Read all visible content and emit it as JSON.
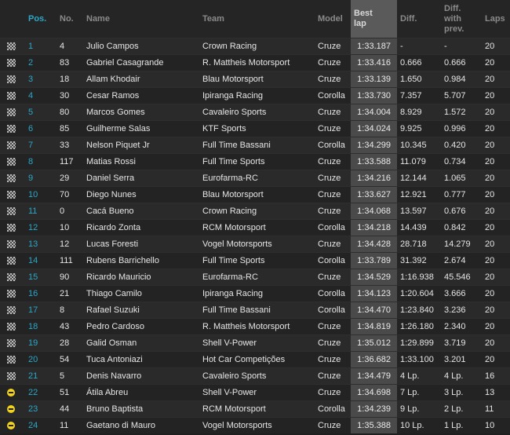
{
  "headers": {
    "pos": "Pos.",
    "no": "No.",
    "name": "Name",
    "team": "Team",
    "model": "Model",
    "best_lap_1": "Best",
    "best_lap_2": "lap",
    "diff": "Diff.",
    "diff_prev_1": "Diff.",
    "diff_prev_2": "with",
    "diff_prev_3": "prev.",
    "laps": "Laps"
  },
  "rows": [
    {
      "flag": "checkered-flag-icon",
      "pos": "1",
      "no": "4",
      "name": "Julio Campos",
      "team": "Crown Racing",
      "model": "Cruze",
      "best": "1:33.187",
      "diff": "-",
      "prev": "-",
      "laps": "20"
    },
    {
      "flag": "checkered-flag-icon",
      "pos": "2",
      "no": "83",
      "name": "Gabriel Casagrande",
      "team": "R. Mattheis Motorsport",
      "model": "Cruze",
      "best": "1:33.416",
      "diff": "0.666",
      "prev": "0.666",
      "laps": "20"
    },
    {
      "flag": "checkered-flag-icon",
      "pos": "3",
      "no": "18",
      "name": "Allam Khodair",
      "team": "Blau Motorsport",
      "model": "Cruze",
      "best": "1:33.139",
      "diff": "1.650",
      "prev": "0.984",
      "laps": "20"
    },
    {
      "flag": "checkered-flag-icon",
      "pos": "4",
      "no": "30",
      "name": "Cesar Ramos",
      "team": "Ipiranga Racing",
      "model": "Corolla",
      "best": "1:33.730",
      "diff": "7.357",
      "prev": "5.707",
      "laps": "20"
    },
    {
      "flag": "checkered-flag-icon",
      "pos": "5",
      "no": "80",
      "name": "Marcos Gomes",
      "team": "Cavaleiro Sports",
      "model": "Cruze",
      "best": "1:34.004",
      "diff": "8.929",
      "prev": "1.572",
      "laps": "20"
    },
    {
      "flag": "checkered-flag-icon",
      "pos": "6",
      "no": "85",
      "name": "Guilherme Salas",
      "team": "KTF Sports",
      "model": "Cruze",
      "best": "1:34.024",
      "diff": "9.925",
      "prev": "0.996",
      "laps": "20"
    },
    {
      "flag": "checkered-flag-icon",
      "pos": "7",
      "no": "33",
      "name": "Nelson Piquet Jr",
      "team": "Full Time Bassani",
      "model": "Corolla",
      "best": "1:34.299",
      "diff": "10.345",
      "prev": "0.420",
      "laps": "20"
    },
    {
      "flag": "checkered-flag-icon",
      "pos": "8",
      "no": "117",
      "name": "Matias Rossi",
      "team": "Full Time Sports",
      "model": "Cruze",
      "best": "1:33.588",
      "diff": "11.079",
      "prev": "0.734",
      "laps": "20"
    },
    {
      "flag": "checkered-flag-icon",
      "pos": "9",
      "no": "29",
      "name": "Daniel Serra",
      "team": "Eurofarma-RC",
      "model": "Cruze",
      "best": "1:34.216",
      "diff": "12.144",
      "prev": "1.065",
      "laps": "20"
    },
    {
      "flag": "checkered-flag-icon",
      "pos": "10",
      "no": "70",
      "name": "Diego Nunes",
      "team": "Blau Motorsport",
      "model": "Cruze",
      "best": "1:33.627",
      "diff": "12.921",
      "prev": "0.777",
      "laps": "20"
    },
    {
      "flag": "checkered-flag-icon",
      "pos": "11",
      "no": "0",
      "name": "Cacá Bueno",
      "team": "Crown Racing",
      "model": "Cruze",
      "best": "1:34.068",
      "diff": "13.597",
      "prev": "0.676",
      "laps": "20"
    },
    {
      "flag": "checkered-flag-icon",
      "pos": "12",
      "no": "10",
      "name": "Ricardo Zonta",
      "team": "RCM Motorsport",
      "model": "Corolla",
      "best": "1:34.218",
      "diff": "14.439",
      "prev": "0.842",
      "laps": "20"
    },
    {
      "flag": "checkered-flag-icon",
      "pos": "13",
      "no": "12",
      "name": "Lucas Foresti",
      "team": "Vogel Motorsports",
      "model": "Cruze",
      "best": "1:34.428",
      "diff": "28.718",
      "prev": "14.279",
      "laps": "20"
    },
    {
      "flag": "checkered-flag-icon",
      "pos": "14",
      "no": "111",
      "name": "Rubens Barrichello",
      "team": "Full Time Sports",
      "model": "Corolla",
      "best": "1:33.789",
      "diff": "31.392",
      "prev": "2.674",
      "laps": "20"
    },
    {
      "flag": "checkered-flag-icon",
      "pos": "15",
      "no": "90",
      "name": "Ricardo Mauricio",
      "team": "Eurofarma-RC",
      "model": "Cruze",
      "best": "1:34.529",
      "diff": "1:16.938",
      "prev": "45.546",
      "laps": "20"
    },
    {
      "flag": "checkered-flag-icon",
      "pos": "16",
      "no": "21",
      "name": "Thiago Camilo",
      "team": "Ipiranga Racing",
      "model": "Corolla",
      "best": "1:34.123",
      "diff": "1:20.604",
      "prev": "3.666",
      "laps": "20"
    },
    {
      "flag": "checkered-flag-icon",
      "pos": "17",
      "no": "8",
      "name": "Rafael Suzuki",
      "team": "Full Time Bassani",
      "model": "Corolla",
      "best": "1:34.470",
      "diff": "1:23.840",
      "prev": "3.236",
      "laps": "20"
    },
    {
      "flag": "checkered-flag-icon",
      "pos": "18",
      "no": "43",
      "name": "Pedro Cardoso",
      "team": "R. Mattheis Motorsport",
      "model": "Cruze",
      "best": "1:34.819",
      "diff": "1:26.180",
      "prev": "2.340",
      "laps": "20"
    },
    {
      "flag": "checkered-flag-icon",
      "pos": "19",
      "no": "28",
      "name": "Galid Osman",
      "team": "Shell V-Power",
      "model": "Cruze",
      "best": "1:35.012",
      "diff": "1:29.899",
      "prev": "3.719",
      "laps": "20"
    },
    {
      "flag": "checkered-flag-icon",
      "pos": "20",
      "no": "54",
      "name": "Tuca Antoniazi",
      "team": "Hot Car Competições",
      "model": "Cruze",
      "best": "1:36.682",
      "diff": "1:33.100",
      "prev": "3.201",
      "laps": "20"
    },
    {
      "flag": "checkered-flag-icon",
      "pos": "21",
      "no": "5",
      "name": "Denis Navarro",
      "team": "Cavaleiro Sports",
      "model": "Cruze",
      "best": "1:34.479",
      "diff": "4 Lp.",
      "prev": "4 Lp.",
      "laps": "16"
    },
    {
      "flag": "pit-icon",
      "pos": "22",
      "no": "51",
      "name": "Átila Abreu",
      "team": "Shell V-Power",
      "model": "Cruze",
      "best": "1:34.698",
      "diff": "7 Lp.",
      "prev": "3 Lp.",
      "laps": "13"
    },
    {
      "flag": "pit-icon",
      "pos": "23",
      "no": "44",
      "name": "Bruno Baptista",
      "team": "RCM Motorsport",
      "model": "Corolla",
      "best": "1:34.239",
      "diff": "9 Lp.",
      "prev": "2 Lp.",
      "laps": "11"
    },
    {
      "flag": "pit-icon",
      "pos": "24",
      "no": "11",
      "name": "Gaetano di Mauro",
      "team": "Vogel Motorsports",
      "model": "Cruze",
      "best": "1:35.388",
      "diff": "10 Lp.",
      "prev": "1 Lp.",
      "laps": "10"
    }
  ],
  "colors": {
    "accent": "#2aa8c8",
    "best_lap_bg": "#4a4a4a",
    "pit_icon": "#f2d21b"
  }
}
